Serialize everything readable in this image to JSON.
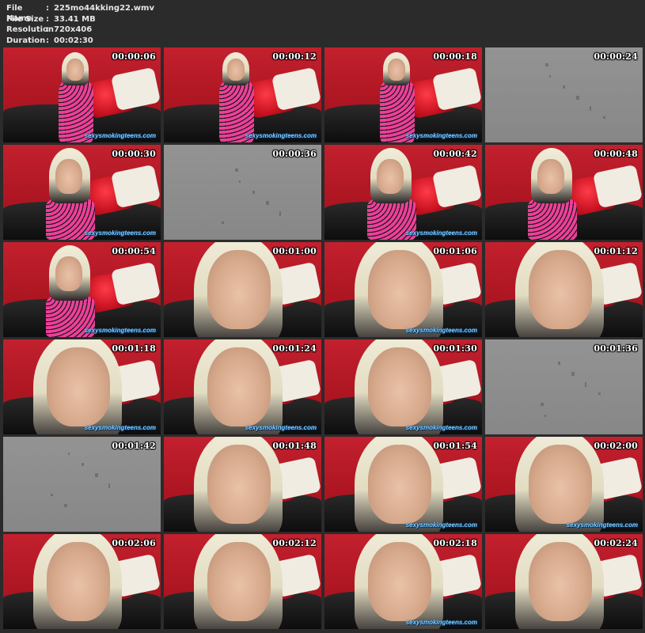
{
  "info": {
    "rows": [
      {
        "key": "File Name",
        "sep": ":",
        "val": "225mo44kking22.wmv"
      },
      {
        "key": "File Size",
        "sep": ":",
        "val": "33.41 MB"
      },
      {
        "key": "Resolution",
        "sep": ":",
        "val": "720x406"
      },
      {
        "key": "Duration",
        "sep": ":",
        "val": "00:02:30"
      }
    ]
  },
  "thumbnails": [
    {
      "time": "00:00:06",
      "scene": "wide",
      "watermark": "sexysmokingteens.com"
    },
    {
      "time": "00:00:12",
      "scene": "wide",
      "watermark": "sexysmokingteens.com"
    },
    {
      "time": "00:00:18",
      "scene": "wide",
      "watermark": "sexysmokingteens.com"
    },
    {
      "time": "00:00:24",
      "scene": "gray",
      "watermark": ""
    },
    {
      "time": "00:00:30",
      "scene": "medium",
      "watermark": "sexysmokingteens.com"
    },
    {
      "time": "00:00:36",
      "scene": "gray",
      "watermark": ""
    },
    {
      "time": "00:00:42",
      "scene": "medium",
      "watermark": "sexysmokingteens.com"
    },
    {
      "time": "00:00:48",
      "scene": "medium",
      "watermark": ""
    },
    {
      "time": "00:00:54",
      "scene": "medium",
      "watermark": "sexysmokingteens.com"
    },
    {
      "time": "00:01:00",
      "scene": "close",
      "watermark": ""
    },
    {
      "time": "00:01:06",
      "scene": "close",
      "watermark": "sexysmokingteens.com"
    },
    {
      "time": "00:01:12",
      "scene": "close",
      "watermark": ""
    },
    {
      "time": "00:01:18",
      "scene": "close",
      "watermark": "sexysmokingteens.com"
    },
    {
      "time": "00:01:24",
      "scene": "close",
      "watermark": "sexysmokingteens.com"
    },
    {
      "time": "00:01:30",
      "scene": "close",
      "watermark": "sexysmokingteens.com"
    },
    {
      "time": "00:01:36",
      "scene": "gray",
      "watermark": ""
    },
    {
      "time": "00:01:42",
      "scene": "gray",
      "watermark": ""
    },
    {
      "time": "00:01:48",
      "scene": "close",
      "watermark": ""
    },
    {
      "time": "00:01:54",
      "scene": "close",
      "watermark": "sexysmokingteens.com"
    },
    {
      "time": "00:02:00",
      "scene": "close",
      "watermark": "sexysmokingteens.com"
    },
    {
      "time": "00:02:06",
      "scene": "close",
      "watermark": ""
    },
    {
      "time": "00:02:12",
      "scene": "close",
      "watermark": ""
    },
    {
      "time": "00:02:18",
      "scene": "close",
      "watermark": "sexysmokingteens.com"
    },
    {
      "time": "00:02:24",
      "scene": "close",
      "watermark": ""
    }
  ]
}
